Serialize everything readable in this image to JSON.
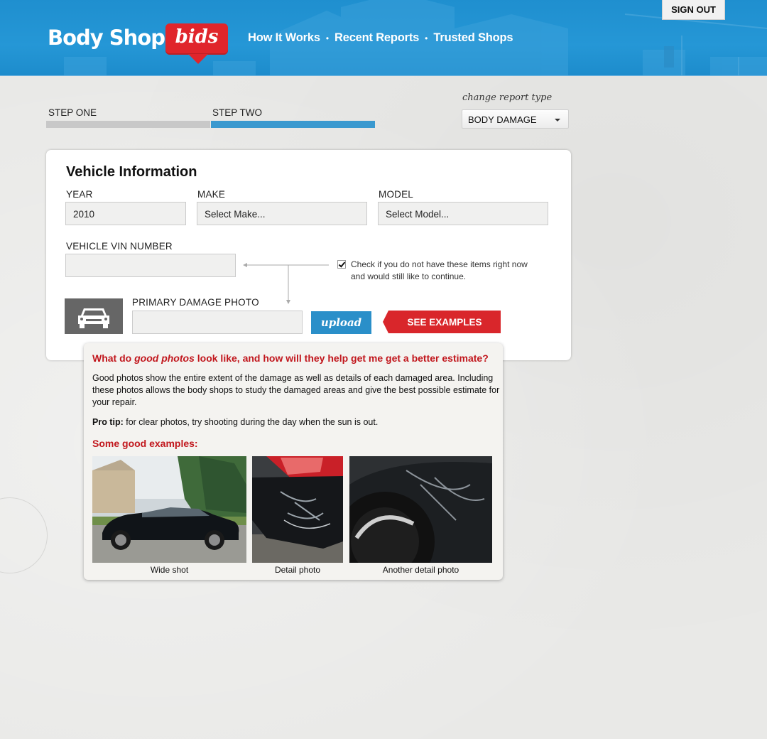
{
  "header": {
    "logo_text": "Body Shop",
    "logo_badge": "bids",
    "nav": [
      "How It Works",
      "Recent Reports",
      "Trusted Shops"
    ],
    "nav_separator": "•",
    "sign_out": "SIGN OUT"
  },
  "steps": {
    "step_one": "STEP ONE",
    "step_two": "STEP TWO",
    "current_step": 2,
    "colors": {
      "inactive": "#c8c8c8",
      "active": "#3a99cf"
    }
  },
  "report_type": {
    "label": "change report type",
    "selected": "BODY DAMAGE"
  },
  "vehicle": {
    "title": "Vehicle Information",
    "year_label": "YEAR",
    "year_value": "2010",
    "make_label": "MAKE",
    "make_placeholder": "Select Make...",
    "model_label": "MODEL",
    "model_placeholder": "Select Model...",
    "vin_label": "VEHICLE VIN NUMBER",
    "vin_value": "",
    "no_items_checked": true,
    "no_items_text": "Check if you do not have these items right now and would still like to continue.",
    "photo_label": "PRIMARY DAMAGE PHOTO",
    "upload_label": "upload",
    "see_examples_label": "SEE EXAMPLES"
  },
  "popup": {
    "question_pre": "What do ",
    "question_em": "good photos",
    "question_post": " look like, and how will they help get me get a better estimate?",
    "body": "Good photos show the entire extent of the damage as well as details of each damaged area. Including these photos allows the body shops to study the damaged areas and give the best possible estimate for your repair.",
    "tip_label": "Pro tip:",
    "tip_text": " for clear photos, try shooting during the day when the sun is out.",
    "examples_heading": "Some good examples:",
    "examples": [
      {
        "caption": "Wide shot"
      },
      {
        "caption": "Detail photo"
      },
      {
        "caption": "Another detail photo"
      }
    ]
  },
  "colors": {
    "header_blue": "#1f8fcf",
    "accent_red": "#d9262b",
    "upload_blue": "#2a8fc9"
  }
}
